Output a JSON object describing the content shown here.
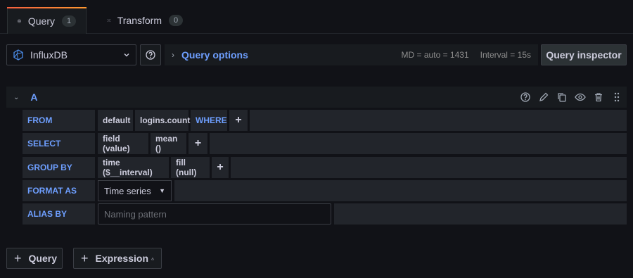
{
  "tabs": [
    {
      "label": "Query",
      "count": "1",
      "icon": "database-icon"
    },
    {
      "label": "Transform",
      "count": "0",
      "icon": "transform-icon"
    }
  ],
  "datasource": {
    "name": "InfluxDB",
    "icon": "influxdb-icon"
  },
  "query_options": {
    "title": "Query options",
    "md": "MD = auto = 1431",
    "interval": "Interval = 15s"
  },
  "inspector_label": "Query inspector",
  "query": {
    "ref_id": "A",
    "from": {
      "label": "FROM",
      "policy": "default",
      "measurement": "logins.count",
      "where": "WHERE",
      "plus": "+"
    },
    "select": {
      "label": "SELECT",
      "field": "field (value)",
      "agg": "mean ()",
      "plus": "+"
    },
    "group_by": {
      "label": "GROUP BY",
      "time": "time ($__interval)",
      "fill": "fill (null)",
      "plus": "+"
    },
    "format_as": {
      "label": "FORMAT AS",
      "value": "Time series"
    },
    "alias_by": {
      "label": "ALIAS BY",
      "placeholder": "Naming pattern"
    }
  },
  "buttons": {
    "add_query": "Query",
    "add_expression": "Expression",
    "expression_icon": "warning-icon"
  },
  "colors": {
    "accent": "#6e9fff",
    "tab_gradient_start": "#f55f3e",
    "tab_gradient_end": "#ff9830"
  }
}
